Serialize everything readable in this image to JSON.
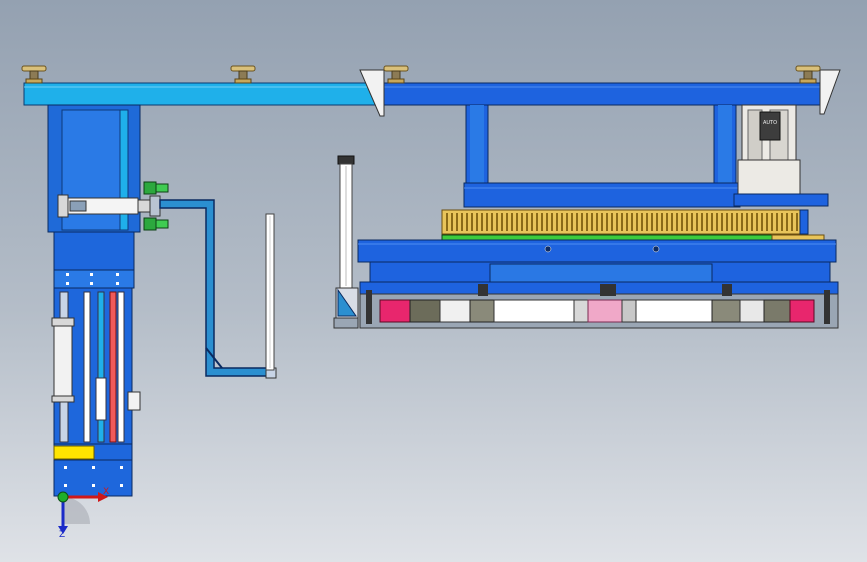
{
  "viewport": {
    "background_top": "#94a1b1",
    "background_bottom": "#dfe2e7"
  },
  "model": {
    "title_text": "",
    "parts": [
      "overhead-beam",
      "vertical-column",
      "pneumatic-cylinder",
      "bracket-frame",
      "guide-rod",
      "rotary-gantry",
      "servo-motor",
      "gear-ring",
      "turntable-plate",
      "roller-assembly",
      "linear-guide"
    ]
  },
  "motor": {
    "label": "AUTO"
  },
  "triad": {
    "x_label": "X",
    "z_label": "Z",
    "x_color": "#d01818",
    "y_color": "#1fae2a",
    "z_color": "#1a2ac8"
  },
  "colors": {
    "beam_light_blue": "#1fb0ea",
    "beam_dark_blue": "#1e63df",
    "column_blue": "#1e67dc",
    "gear_yellow": "#e8c45a",
    "gear_green": "#3dcb3d",
    "roller_pink": "#e8266d",
    "motor_white": "#eceae5"
  }
}
